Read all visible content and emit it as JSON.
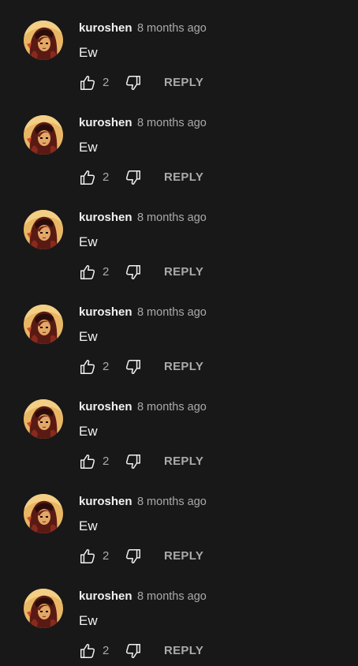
{
  "comments": [
    {
      "author": "kuroshen",
      "time": "8 months ago",
      "text": "Ew",
      "likes": "2",
      "reply_label": "REPLY"
    },
    {
      "author": "kuroshen",
      "time": "8 months ago",
      "text": "Ew",
      "likes": "2",
      "reply_label": "REPLY"
    },
    {
      "author": "kuroshen",
      "time": "8 months ago",
      "text": "Ew",
      "likes": "2",
      "reply_label": "REPLY"
    },
    {
      "author": "kuroshen",
      "time": "8 months ago",
      "text": "Ew",
      "likes": "2",
      "reply_label": "REPLY"
    },
    {
      "author": "kuroshen",
      "time": "8 months ago",
      "text": "Ew",
      "likes": "2",
      "reply_label": "REPLY"
    },
    {
      "author": "kuroshen",
      "time": "8 months ago",
      "text": "Ew",
      "likes": "2",
      "reply_label": "REPLY"
    },
    {
      "author": "kuroshen",
      "time": "8 months ago",
      "text": "Ew",
      "likes": "2",
      "reply_label": "REPLY"
    }
  ],
  "icons": {
    "like": "thumb-up-icon",
    "dislike": "thumb-down-icon"
  },
  "colors": {
    "background": "#181818",
    "text_primary": "#f1f1f1",
    "text_secondary": "#aaaaaa"
  }
}
